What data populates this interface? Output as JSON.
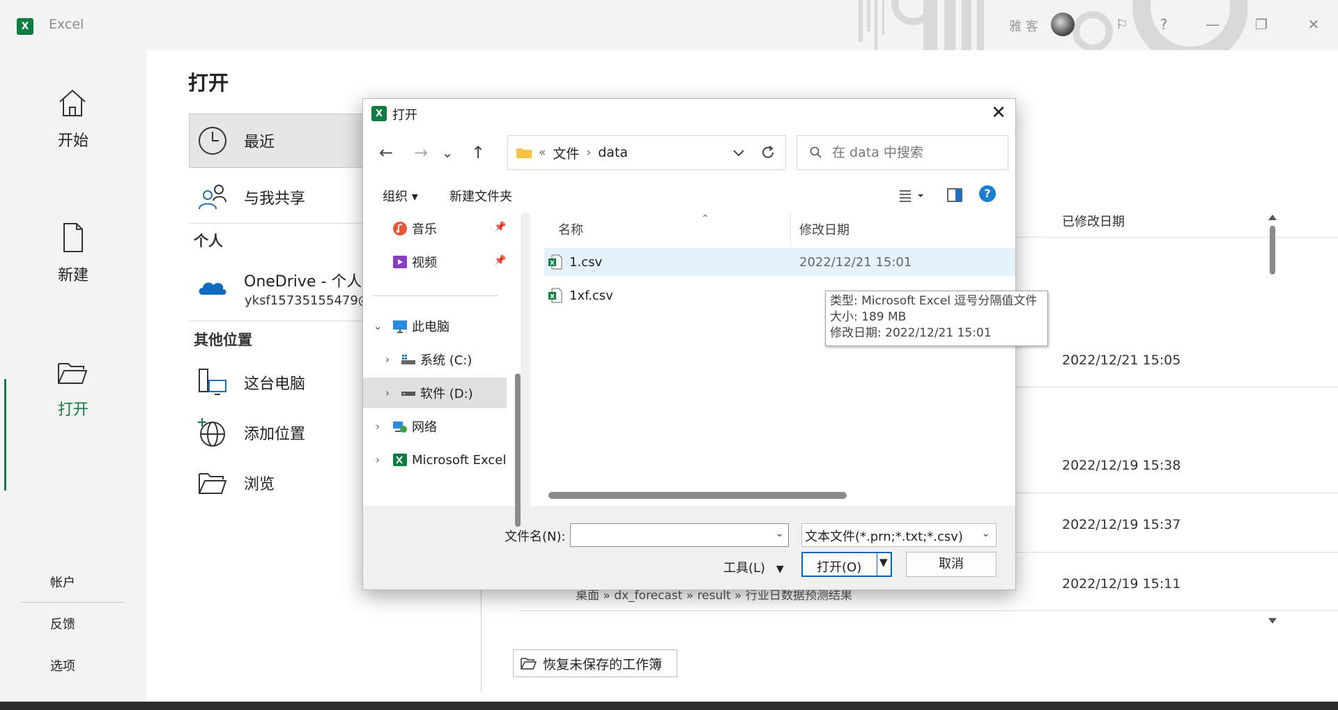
{
  "app": {
    "logo": "X",
    "title": "Excel",
    "user": "雅 客"
  },
  "window": {
    "minimize": "—",
    "restore": "❐",
    "close": "✕"
  },
  "leftnav": {
    "items": [
      {
        "label": "开始",
        "icon": "home-icon"
      },
      {
        "label": "新建",
        "icon": "new-document-icon"
      },
      {
        "label": "打开",
        "icon": "open-folder-icon"
      }
    ],
    "bottom": [
      "帐户",
      "反馈",
      "选项"
    ]
  },
  "main": {
    "title": "打开",
    "locations": {
      "recent": "最近",
      "shared": "与我共享",
      "personal_heading": "个人",
      "onedrive": "OneDrive - 个人",
      "onedrive_account": "yksf15735155479@",
      "other_heading": "其他位置",
      "this_pc": "这台电脑",
      "add_place": "添加位置",
      "browse": "浏览"
    },
    "column_modified": "已修改日期",
    "dates": [
      "2022/12/21 15:05",
      "2022/12/19 15:38",
      "2022/12/19 15:37",
      "2022/12/19 15:11"
    ],
    "partial_path": "桌面 » dx_forecast » result » 行业日数据预测结果",
    "recover_button": "恢复未保存的工作簿"
  },
  "dialog": {
    "title": "打开",
    "close": "✕",
    "nav": {
      "back": "←",
      "forward": "→",
      "recent": "⌄",
      "up": "↑"
    },
    "address": {
      "overflow": "«",
      "crumbs": [
        "文件",
        "data"
      ],
      "sep": "›"
    },
    "search_placeholder": "在 data 中搜索",
    "toolbar": {
      "organize": "组织 ▾",
      "new_folder": "新建文件夹",
      "help": "?"
    },
    "nav_pane": {
      "music": "音乐",
      "video": "视频",
      "this_pc": "此电脑",
      "drive_c": "系统 (C:)",
      "drive_d": "软件 (D:)",
      "network": "网络",
      "excel": "Microsoft Excel"
    },
    "columns": {
      "name": "名称",
      "modified": "修改日期"
    },
    "files": [
      {
        "name": "1.csv",
        "date": "2022/12/21 15:01"
      },
      {
        "name": "1xf.csv",
        "date": ""
      }
    ],
    "tooltip": {
      "type": "类型: Microsoft Excel 逗号分隔值文件",
      "size": "大小: 189 MB",
      "modified": "修改日期: 2022/12/21 15:01"
    },
    "filename_label": "文件名(N):",
    "filename_value": "",
    "filetype": "文本文件(*.prn;*.txt;*.csv)",
    "tools": "工具(L)",
    "open": "打开(O)",
    "cancel": "取消"
  }
}
